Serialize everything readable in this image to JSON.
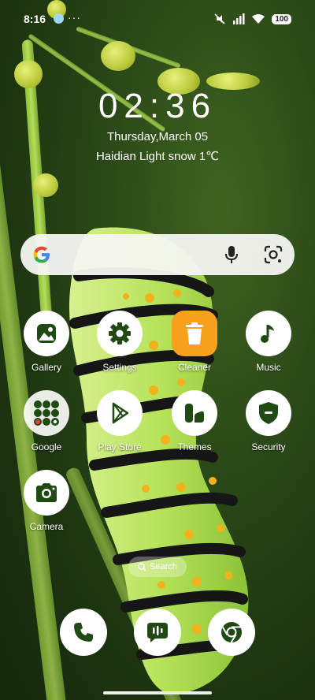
{
  "status_bar": {
    "time": "8:16",
    "more": "···",
    "battery": "100"
  },
  "clock": {
    "time": "02:36",
    "date": "Thursday,March 05",
    "weather": "Haidian Light snow 1℃"
  },
  "search_widget": {
    "google_icon": "google-icon",
    "mic_icon": "mic-icon",
    "lens_icon": "lens-icon"
  },
  "apps": [
    {
      "label": "Gallery",
      "icon": "gallery-icon"
    },
    {
      "label": "Settings",
      "icon": "gear-icon"
    },
    {
      "label": "Cleaner",
      "icon": "trash-icon"
    },
    {
      "label": "Music",
      "icon": "music-note-icon"
    },
    {
      "label": "Google",
      "icon": "google-folder-icon"
    },
    {
      "label": "Play Store",
      "icon": "play-store-icon"
    },
    {
      "label": "Themes",
      "icon": "themes-icon"
    },
    {
      "label": "Security",
      "icon": "shield-icon"
    },
    {
      "label": "Camera",
      "icon": "camera-icon"
    }
  ],
  "search_pill": {
    "label": "Search"
  },
  "dock": [
    {
      "icon": "phone-icon"
    },
    {
      "icon": "messages-icon"
    },
    {
      "icon": "chrome-icon"
    }
  ],
  "colors": {
    "cleaner_orange": "#f7a11c",
    "icon_dark": "#1f4a14",
    "wallpaper_green": "#2c4a18"
  }
}
